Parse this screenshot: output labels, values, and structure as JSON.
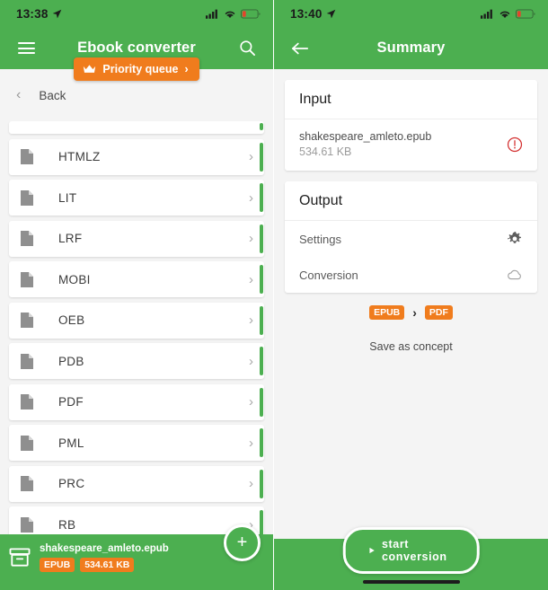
{
  "left": {
    "statusbar": {
      "time": "13:38",
      "location_icon": "location-arrow-icon",
      "signal_icon": "cellular-signal-icon",
      "wifi_icon": "wifi-icon",
      "battery_icon": "battery-low-icon"
    },
    "appbar": {
      "menu_icon": "hamburger-menu-icon",
      "title": "Ebook converter",
      "search_icon": "search-icon"
    },
    "priority": {
      "label": "Priority queue",
      "crown_icon": "crown-icon",
      "chevron": "›",
      "color": "#f07c1d"
    },
    "back": {
      "chevron": "‹",
      "label": "Back"
    },
    "formats": [
      {
        "label": "HTMLZ",
        "icon": "document-icon",
        "chevron": "›"
      },
      {
        "label": "LIT",
        "icon": "document-icon",
        "chevron": "›"
      },
      {
        "label": "LRF",
        "icon": "document-icon",
        "chevron": "›"
      },
      {
        "label": "MOBI",
        "icon": "document-icon",
        "chevron": "›"
      },
      {
        "label": "OEB",
        "icon": "document-icon",
        "chevron": "›"
      },
      {
        "label": "PDB",
        "icon": "document-icon",
        "chevron": "›"
      },
      {
        "label": "PDF",
        "icon": "document-icon",
        "chevron": "›"
      },
      {
        "label": "PML",
        "icon": "document-icon",
        "chevron": "›"
      },
      {
        "label": "PRC",
        "icon": "document-icon",
        "chevron": "›"
      },
      {
        "label": "RB",
        "icon": "document-icon",
        "chevron": "›"
      }
    ],
    "fab": {
      "label": "+",
      "icon": "add-icon"
    },
    "bottom": {
      "icon": "archive-box-icon",
      "filename": "shakespeare_amleto.epub",
      "format_badge": "EPUB",
      "size_badge": "534.61 KB"
    }
  },
  "right": {
    "statusbar": {
      "time": "13:40",
      "location_icon": "location-arrow-icon",
      "signal_icon": "cellular-signal-icon",
      "wifi_icon": "wifi-icon",
      "battery_icon": "battery-low-icon"
    },
    "appbar": {
      "back_icon": "arrow-left-icon",
      "title": "Summary"
    },
    "input_card": {
      "heading": "Input",
      "filename": "shakespeare_amleto.epub",
      "filesize": "534.61 KB",
      "status_icon": "error-exclamation-icon"
    },
    "output_card": {
      "heading": "Output",
      "rows": [
        {
          "label": "Settings",
          "icon": "gear-icon"
        },
        {
          "label": "Conversion",
          "icon": "cloud-icon"
        }
      ]
    },
    "flow": {
      "from": "EPUB",
      "arrow": "›",
      "to": "PDF"
    },
    "save_concept": "Save as concept",
    "start_button": {
      "label": "start conversion",
      "icon": "play-icon"
    }
  },
  "colors": {
    "brand_green": "#4caf50",
    "accent_orange": "#f07c1d",
    "error_red": "#d32f2f"
  }
}
